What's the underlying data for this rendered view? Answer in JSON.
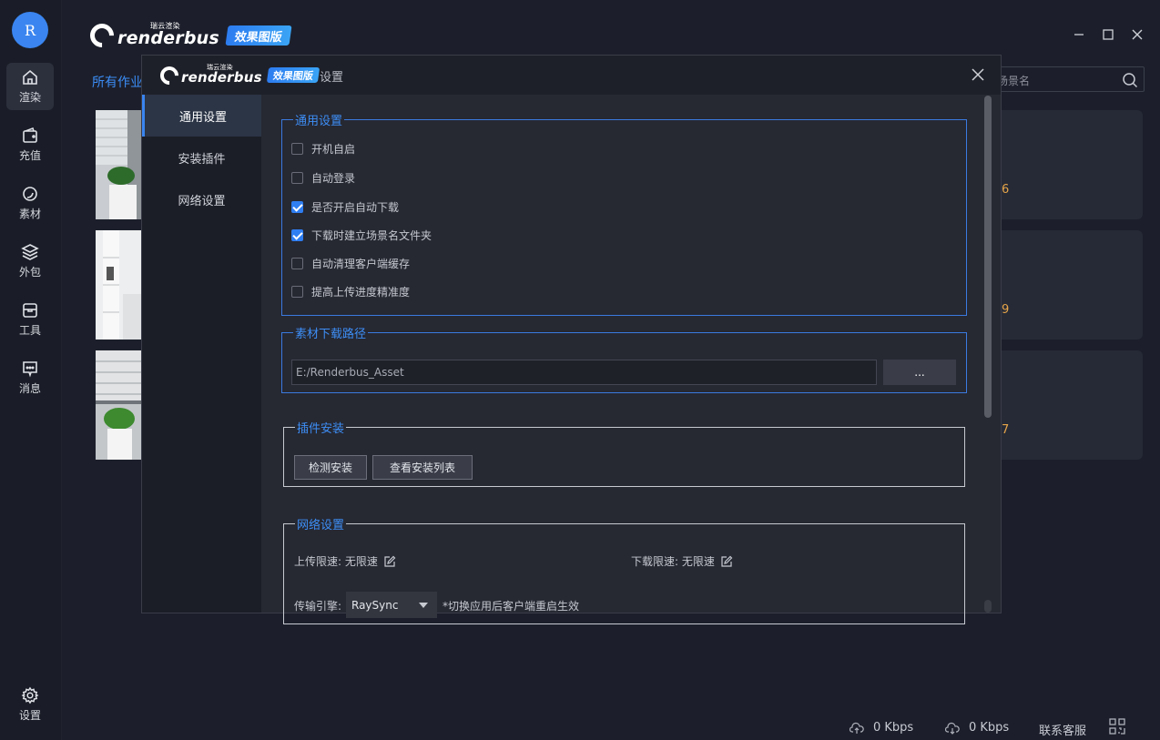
{
  "app": {
    "avatar_letter": "R",
    "brand_cn": "瑞云渲染",
    "brand_word": "renderbus",
    "brand_tag": "效果图版"
  },
  "rail": [
    {
      "label": "渲染",
      "icon": "home-icon"
    },
    {
      "label": "充值",
      "icon": "wallet-icon"
    },
    {
      "label": "素材",
      "icon": "asset-icon"
    },
    {
      "label": "外包",
      "icon": "layers-icon"
    },
    {
      "label": "工具",
      "icon": "toolbox-icon"
    },
    {
      "label": "消息",
      "icon": "message-icon"
    }
  ],
  "rail_bottom": {
    "label": "设置",
    "icon": "gear-icon"
  },
  "main": {
    "all_jobs": "所有作业",
    "search_placeholder": "场景名",
    "card_numbers": [
      "6",
      "9",
      "7"
    ]
  },
  "status": {
    "upload_speed": "0 Kbps",
    "download_speed": "0 Kbps",
    "support": "联系客服"
  },
  "modal": {
    "title": "设置",
    "nav": [
      "通用设置",
      "安装插件",
      "网络设置"
    ],
    "general": {
      "legend": "通用设置",
      "options": [
        {
          "label": "开机自启",
          "checked": false
        },
        {
          "label": "自动登录",
          "checked": false
        },
        {
          "label": "是否开启自动下载",
          "checked": true
        },
        {
          "label": "下载时建立场景名文件夹",
          "checked": true
        },
        {
          "label": "自动清理客户端缓存",
          "checked": false
        },
        {
          "label": "提高上传进度精准度",
          "checked": false
        }
      ]
    },
    "download_path": {
      "legend": "素材下载路径",
      "value": "E:/Renderbus_Asset",
      "browse_label": "..."
    },
    "plugins": {
      "legend": "插件安装",
      "detect_label": "检测安装",
      "list_label": "查看安装列表"
    },
    "network": {
      "legend": "网络设置",
      "upload_label": "上传限速:",
      "upload_value": "无限速",
      "download_label": "下载限速:",
      "download_value": "无限速",
      "engine_label": "传输引擎:",
      "engine_value": "RaySync",
      "engine_hint": "*切换应用后客户端重启生效"
    }
  }
}
